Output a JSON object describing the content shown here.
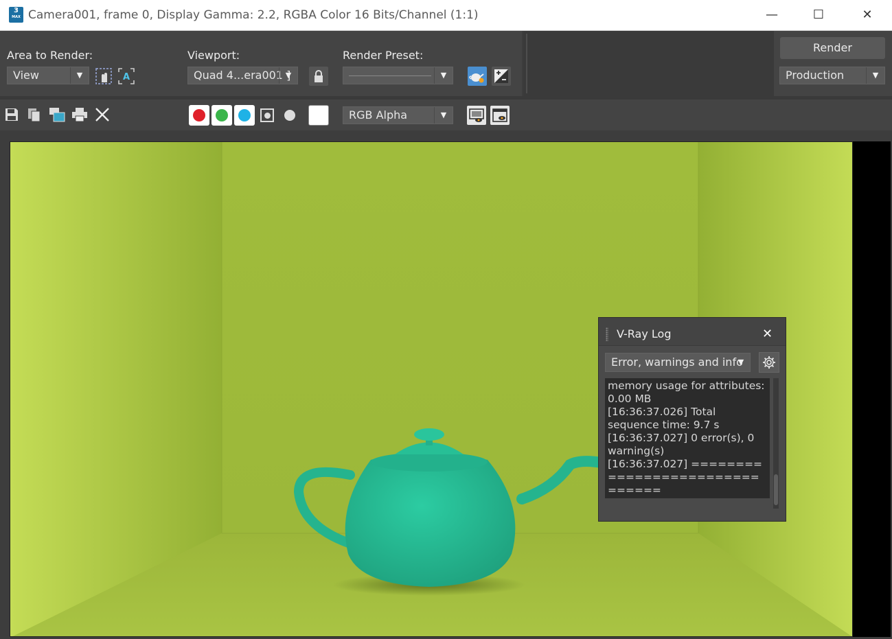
{
  "window": {
    "icon_text": "3",
    "icon_subtext": "MAX",
    "title": "Camera001, frame 0, Display Gamma: 2.2, RGBA Color 16 Bits/Channel (1:1)",
    "controls": {
      "minimize": "—",
      "maximize": "☐",
      "close": "✕"
    }
  },
  "render_settings": {
    "area_label": "Area to Render:",
    "area_value": "View",
    "viewport_label": "Viewport:",
    "viewport_value": "Quad 4...era001 ]",
    "preset_label": "Render Preset:",
    "preset_value": "",
    "render_button": "Render",
    "production_value": "Production"
  },
  "toolbar": {
    "channel_value": "RGB Alpha",
    "colors": {
      "red": "#e0202a",
      "green": "#3ab54a",
      "blue": "#1fb2e6"
    }
  },
  "scene": {
    "wall_color": "#9ab83a",
    "teapot_color": "#27bf96"
  },
  "vray_log": {
    "title": "V-Ray Log",
    "close": "✕",
    "filter_value": "Error, warnings and info",
    "lines": [
      "memory usage for attributes: 0.00 MB",
      "[16:36:37.026] Total sequence time: 9.7 s",
      "[16:36:37.027] 0 error(s), 0 warning(s)",
      "[16:36:37.027] ==============================="
    ]
  }
}
